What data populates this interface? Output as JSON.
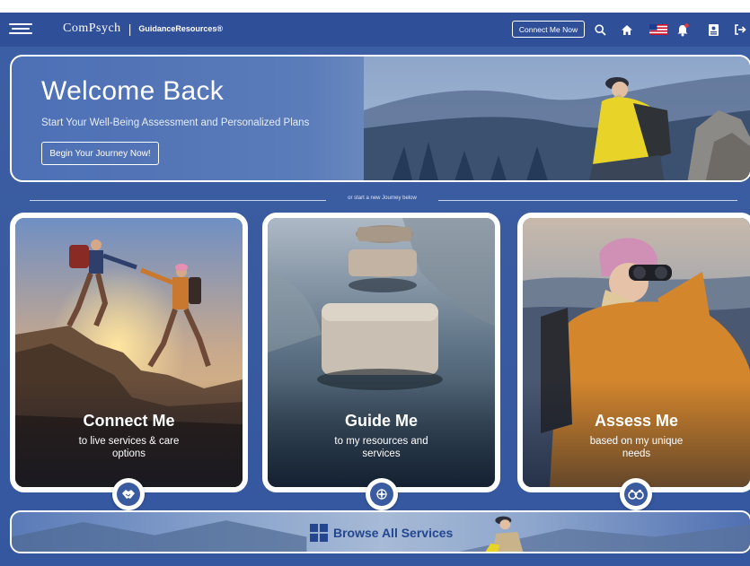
{
  "header": {
    "brand": "ComPsych",
    "brand_tagline": "GuidanceResources®",
    "separator": "|",
    "connect_label": "Connect Me Now"
  },
  "hero": {
    "title": "Welcome Back",
    "subtitle": "Start Your Well-Being Assessment and Personalized Plans",
    "button_label": "Begin Your Journey Now!"
  },
  "divider": {
    "text": "or start a new Journey below"
  },
  "cards": [
    {
      "title": "Connect Me",
      "description": "to live services & care options",
      "icon": "handshake-icon"
    },
    {
      "title": "Guide Me",
      "description": "to my resources and services",
      "icon": "compass-icon"
    },
    {
      "title": "Assess Me",
      "description": "based on my unique needs",
      "icon": "binoculars-icon"
    }
  ],
  "browse": {
    "label": "Browse All Services"
  },
  "colors": {
    "primary": "#3a5ba0",
    "nav": "#2f4f99",
    "browse_text": "#23468f"
  }
}
